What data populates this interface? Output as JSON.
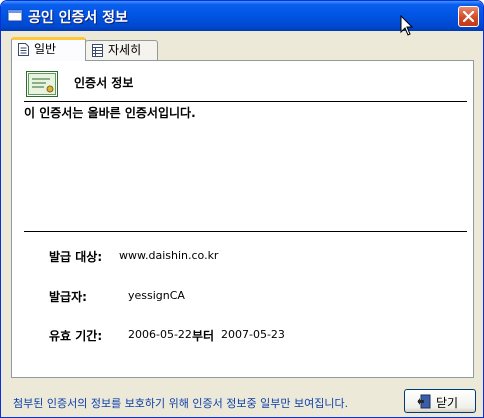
{
  "window": {
    "title": "공인 인증서 정보"
  },
  "tabs": [
    {
      "label": "일반",
      "selected": true
    },
    {
      "label": "자세히",
      "selected": false
    }
  ],
  "general": {
    "heading": "인증서 정보",
    "status": "이 인증서는 올바른 인증서입니다.",
    "issued_to_label": "발급 대상:",
    "issued_to_value": "www.daishin.co.kr",
    "issued_by_label": "발급자:",
    "issued_by_value": "yessignCA",
    "validity_label": "유효 기간:",
    "valid_from": "2006-05-22",
    "to_label": "부터",
    "valid_to": "2007-05-23"
  },
  "footer": {
    "note": "첨부된 인증서의 정보를 보호하기 위해 인증서 정보중 일부만 보여집니다.",
    "close_label": "닫기"
  },
  "colors": {
    "titlebar": "#0054e3",
    "dialog_bg": "#ece9d8",
    "note_text": "#0b3ea9",
    "close_x": "#c0391a"
  }
}
